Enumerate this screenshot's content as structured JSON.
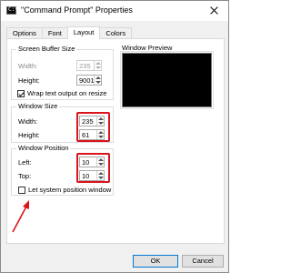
{
  "window": {
    "title": "\"Command Prompt\" Properties",
    "icon": "cmd-icon",
    "icon_glyph": "C:\\"
  },
  "tabs": [
    {
      "label": "Options",
      "active": false
    },
    {
      "label": "Font",
      "active": false
    },
    {
      "label": "Layout",
      "active": true
    },
    {
      "label": "Colors",
      "active": false
    }
  ],
  "screen_buffer": {
    "title": "Screen Buffer Size",
    "width_label": "Width:",
    "width_value": "235",
    "height_label": "Height:",
    "height_value": "9001",
    "wrap_label": "Wrap text output on resize",
    "wrap_checked": true
  },
  "window_size": {
    "title": "Window Size",
    "width_label": "Width:",
    "width_value": "235",
    "height_label": "Height:",
    "height_value": "61"
  },
  "window_position": {
    "title": "Window Position",
    "left_label": "Left:",
    "left_value": "10",
    "top_label": "Top:",
    "top_value": "10",
    "let_system_label": "Let system position window",
    "let_system_checked": false
  },
  "preview": {
    "label": "Window Preview"
  },
  "buttons": {
    "ok": "OK",
    "cancel": "Cancel"
  },
  "colors": {
    "highlight": "#d9141c",
    "preview_bg": "#000000"
  }
}
